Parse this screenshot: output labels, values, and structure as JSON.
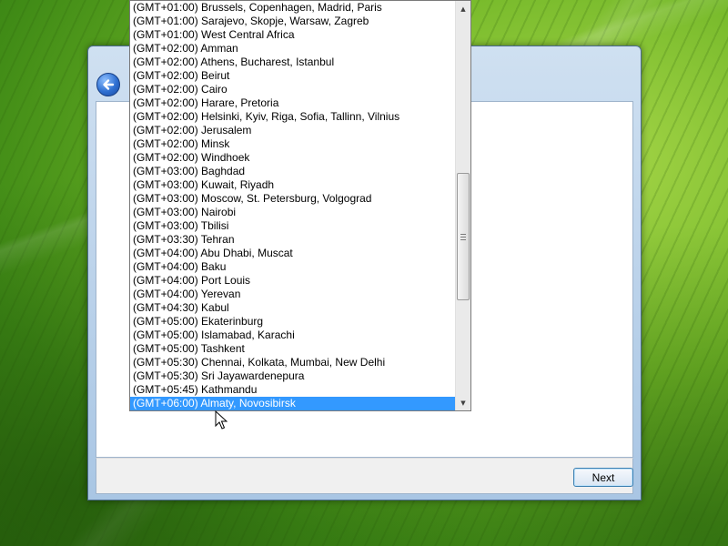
{
  "desktop": {
    "wallpaper": "green leaf"
  },
  "dialog": {
    "back_icon": "back-arrow-icon",
    "next_label": "Next"
  },
  "timezone_list": {
    "items": [
      "(GMT+01:00) Brussels, Copenhagen, Madrid, Paris",
      "(GMT+01:00) Sarajevo, Skopje, Warsaw, Zagreb",
      "(GMT+01:00) West Central Africa",
      "(GMT+02:00) Amman",
      "(GMT+02:00) Athens, Bucharest, Istanbul",
      "(GMT+02:00) Beirut",
      "(GMT+02:00) Cairo",
      "(GMT+02:00) Harare, Pretoria",
      "(GMT+02:00) Helsinki, Kyiv, Riga, Sofia, Tallinn, Vilnius",
      "(GMT+02:00) Jerusalem",
      "(GMT+02:00) Minsk",
      "(GMT+02:00) Windhoek",
      "(GMT+03:00) Baghdad",
      "(GMT+03:00) Kuwait, Riyadh",
      "(GMT+03:00) Moscow, St. Petersburg, Volgograd",
      "(GMT+03:00) Nairobi",
      "(GMT+03:00) Tbilisi",
      "(GMT+03:30) Tehran",
      "(GMT+04:00) Abu Dhabi, Muscat",
      "(GMT+04:00) Baku",
      "(GMT+04:00) Port Louis",
      "(GMT+04:00) Yerevan",
      "(GMT+04:30) Kabul",
      "(GMT+05:00) Ekaterinburg",
      "(GMT+05:00) Islamabad, Karachi",
      "(GMT+05:00) Tashkent",
      "(GMT+05:30) Chennai, Kolkata, Mumbai, New Delhi",
      "(GMT+05:30) Sri Jayawardenepura",
      "(GMT+05:45) Kathmandu",
      "(GMT+06:00) Almaty, Novosibirsk"
    ],
    "selected": "(GMT+06:00) Almaty, Novosibirsk",
    "scroll_up_icon": "scroll-up-arrow-icon",
    "scroll_down_icon": "scroll-down-arrow-icon",
    "selection_color": "#3399ff"
  }
}
